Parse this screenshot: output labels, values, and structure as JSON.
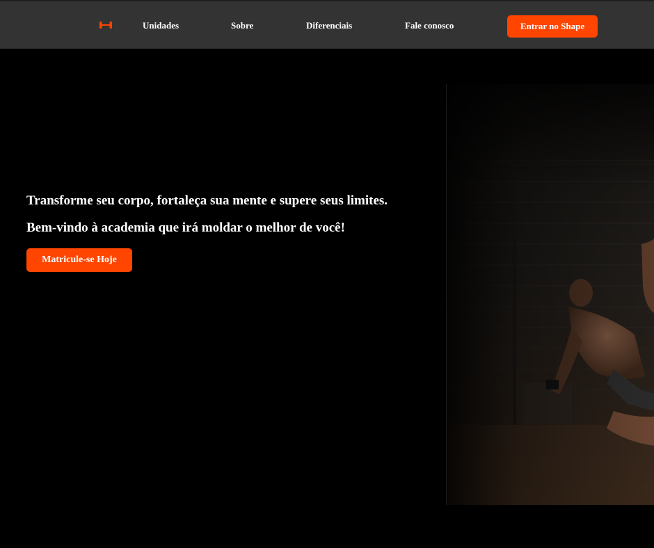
{
  "colors": {
    "accent": "#ff4500",
    "navbar_bg": "#333333",
    "page_bg": "#000000",
    "text": "#ffffff"
  },
  "nav": {
    "logo_icon": "dumbbell-icon",
    "links": [
      {
        "label": "Unidades"
      },
      {
        "label": "Sobre"
      },
      {
        "label": "Diferenciais"
      },
      {
        "label": "Fale conosco"
      }
    ],
    "cta_label": "Entrar no Shape"
  },
  "hero": {
    "headline": "Transforme seu corpo, fortaleça sua mente e supere seus limites.",
    "subheadline": "Bem-vindo à academia que irá moldar o melhor de você!",
    "cta_label": "Matricule-se Hoje",
    "image": "gym-athletes-photo"
  }
}
